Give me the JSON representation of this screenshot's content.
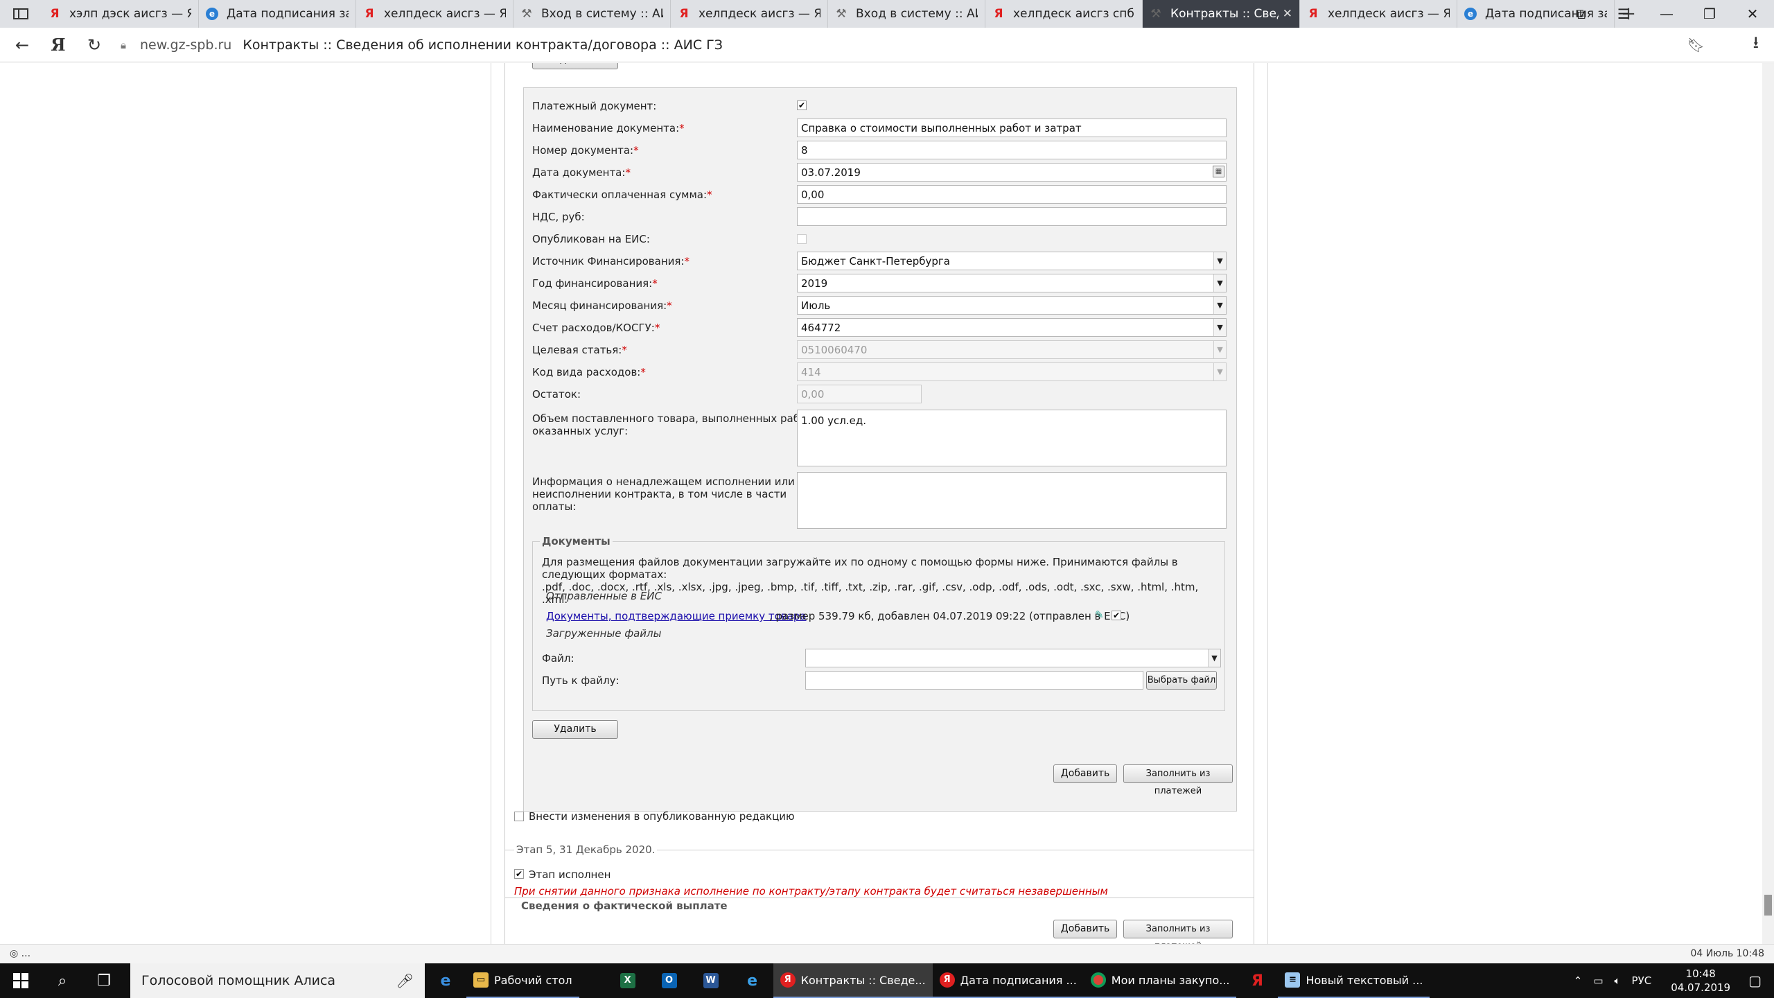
{
  "browser": {
    "tabs": [
      {
        "label": "хэлп дэск аисгз — Ян",
        "icon": "yandex"
      },
      {
        "label": "Дата подписания зак",
        "icon": "ie"
      },
      {
        "label": "хелпдеск аисгз — Ян",
        "icon": "yandex"
      },
      {
        "label": "Вход в систему :: АИС",
        "icon": "ais"
      },
      {
        "label": "хелпдеск аисгз — Ян",
        "icon": "yandex"
      },
      {
        "label": "Вход в систему :: АИС",
        "icon": "ais"
      },
      {
        "label": "хелпдеск аисгз спб —",
        "icon": "yandex"
      },
      {
        "label": "Контракты :: Сведе",
        "icon": "ais",
        "active": true
      },
      {
        "label": "хелпдеск аисгз — Ян",
        "icon": "yandex"
      },
      {
        "label": "Дата подписания зак",
        "icon": "ie"
      }
    ],
    "domain": "new.gz-spb.ru",
    "page_title": "Контракты :: Сведения об исполнении контракта/договора :: АИС ГЗ",
    "status_left": "◎ ...",
    "status_right": "04 Июль 10:48"
  },
  "form": {
    "payment_doc_label": "Платежный документ:",
    "doc_name_label": "Наименование документа:",
    "doc_name_value": "Справка о стоимости выполненных работ и затрат",
    "doc_number_label": "Номер документа:",
    "doc_number_value": "8",
    "doc_date_label": "Дата документа:",
    "doc_date_value": "03.07.2019",
    "paid_sum_label": "Фактически оплаченная сумма:",
    "paid_sum_value": "0,00",
    "vat_label": "НДС, руб:",
    "vat_value": "",
    "published_label": "Опубликован на ЕИС:",
    "source_label": "Источник Финансирования:",
    "source_value": "Бюджет Санкт-Петербурга",
    "year_label": "Год финансирования:",
    "year_value": "2019",
    "month_label": "Месяц финансирования:",
    "month_value": "Июль",
    "account_label": "Счет расходов/КОСГУ:",
    "account_value": "464772",
    "target_label": "Целевая статья:",
    "target_value": "0510060470",
    "expense_code_label": "Код вида расходов:",
    "expense_code_value": "414",
    "remainder_label": "Остаток:",
    "remainder_value": "0,00",
    "volume_label_1": "Объем поставленного товара, выполненных работ,",
    "volume_label_2": "оказанных услуг:",
    "volume_value": "1.00 усл.ед.",
    "improper_label_1": "Информация о ненадлежащем исполнении или",
    "improper_label_2": "неисполнении контракта, в том числе в части",
    "improper_label_3": "оплаты:",
    "required_mark": "*"
  },
  "documents": {
    "legend": "Документы",
    "info_1": "Для размещения файлов документации загружайте их по одному с помощью формы ниже. Принимаются файлы в следующих форматах:",
    "info_2": ".pdf, .doc, .docx, .rtf, .xls, .xlsx, .jpg, .jpeg, .bmp, .tif, .tiff, .txt, .zip, .rar, .gif, .csv, .odp, .odf, .ods, .odt, .sxc, .sxw, .html, .htm, .xml.",
    "sent_label": "Отправленные в ЕИС",
    "file_link": "Документы, подтверждающие приемку товара",
    "file_info": ", размер 539.79 кб, добавлен 04.07.2019 09:22 (отправлен в ЕИС)",
    "uploaded_label": "Загруженные файлы",
    "file_label": "Файл:",
    "file_value": "",
    "path_label": "Путь к файлу:",
    "path_value": "",
    "choose_button": "Выбрать файл"
  },
  "actions": {
    "delete_button": "Удалить",
    "add_button": "Добавить",
    "fill_button": "Заполнить из платежей",
    "publish_changes_label": "Внести изменения в опубликованную редакцию"
  },
  "stage5": {
    "legend": "Этап 5, 31 Декабрь 2020.",
    "done_label": "Этап исполнен",
    "warning": "При снятии данного признака исполнение по контракту/этапу контракта будет считаться незавершенным",
    "payment_info": "Сведения о фактической выплате",
    "add_button": "Добавить",
    "fill_button": "Заполнить из платежей"
  },
  "taskbar": {
    "search_placeholder": "Голосовой помощник Алиса",
    "apps": [
      {
        "label": "Рабочий стол",
        "icon": "folder"
      },
      {
        "label": "Контракты :: Сведе...",
        "icon": "yandex",
        "active": true
      },
      {
        "label": "Дата подписания ...",
        "icon": "yandex"
      },
      {
        "label": "Мои планы закупо...",
        "icon": "chrome"
      },
      {
        "label": "Новый текстовый ...",
        "icon": "notepad"
      }
    ],
    "lang": "РУС",
    "time": "10:48",
    "date": "04.07.2019"
  }
}
